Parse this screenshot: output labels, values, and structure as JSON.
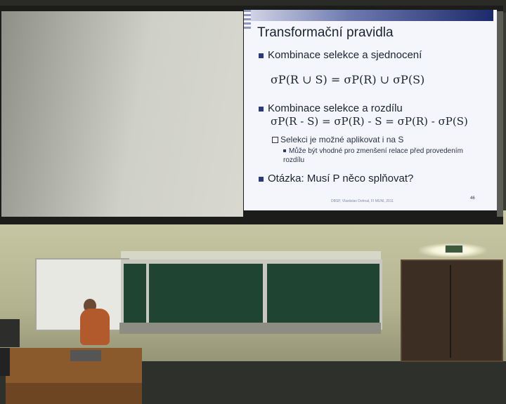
{
  "slide": {
    "title": "Transformační pravidla",
    "bullet1": "Kombinace selekce a sjednocení",
    "formula1": "σP(R ∪ S) = σP(R) ∪ σP(S)",
    "bullet2": "Kombinace selekce a rozdílu",
    "formula2": "σP(R - S) = σP(R) - S = σP(R) - σP(S)",
    "sub1": "Selekci je možné aplikovat i na S",
    "subsub1": "Může být vhodné pro zmenšení relace před provedením rozdílu",
    "bullet3": "Otázka: Musí P něco splňovat?",
    "footer": "DBSP, Vlastislav Dohnal, FI MUNI, 2011",
    "page_number": "46"
  }
}
